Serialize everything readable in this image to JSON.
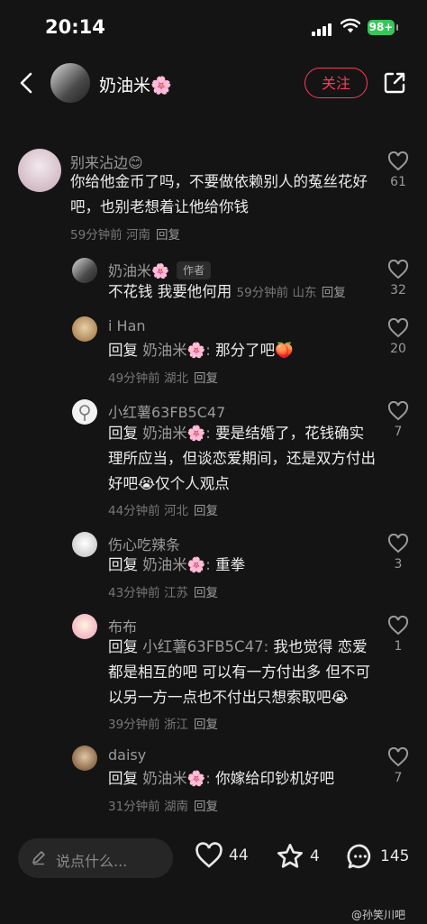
{
  "status": {
    "time": "20:14",
    "battery": "98+"
  },
  "header": {
    "name": "奶油米🌸",
    "follow": "关注"
  },
  "comments": [
    {
      "user": "别来沾边😊",
      "text": "你给他金币了吗，不要做依赖别人的菟丝花好吧，也别老想着让他给你钱",
      "meta": "59分钟前 河南",
      "reply": "回复",
      "likes": "61"
    },
    {
      "user": "奶油米🌸",
      "tag": "作者",
      "text": "不花钱 我要他何用",
      "meta": "59分钟前 山东",
      "reply": "回复",
      "likes": "32"
    },
    {
      "user": "i Han",
      "reply_prefix": "回复",
      "mention": "奶油米🌸:",
      "text": "那分了吧🍑",
      "meta": "49分钟前 湖北",
      "reply": "回复",
      "likes": "20"
    },
    {
      "user": "小红薯63FB5C47",
      "reply_prefix": "回复",
      "mention": "奶油米🌸:",
      "text": "要是结婚了，花钱确实理所应当，但谈恋爱期间，还是双方付出好吧😭仅个人观点",
      "meta": "44分钟前 河北",
      "reply": "回复",
      "likes": "7"
    },
    {
      "user": "伤心吃辣条",
      "reply_prefix": "回复",
      "mention": "奶油米🌸:",
      "text": "重拳",
      "meta": "43分钟前 江苏",
      "reply": "回复",
      "likes": "3"
    },
    {
      "user": "布布",
      "reply_prefix": "回复",
      "mention": "小红薯63FB5C47:",
      "text": "我也觉得 恋爱都是相互的吧 可以有一方付出多 但不可以另一方一点也不付出只想索取吧😭",
      "meta": "39分钟前 浙江",
      "reply": "回复",
      "likes": "1"
    },
    {
      "user": "daisy",
      "reply_prefix": "回复",
      "mention": "奶油米🌸:",
      "text": "你嫁给印钞机好吧",
      "meta": "31分钟前 湖南",
      "reply": "回复",
      "likes": "7"
    }
  ],
  "bottom": {
    "placeholder": "说点什么...",
    "likes": "44",
    "stars": "4",
    "comments": "145",
    "watermark": "@孙笑川吧"
  }
}
